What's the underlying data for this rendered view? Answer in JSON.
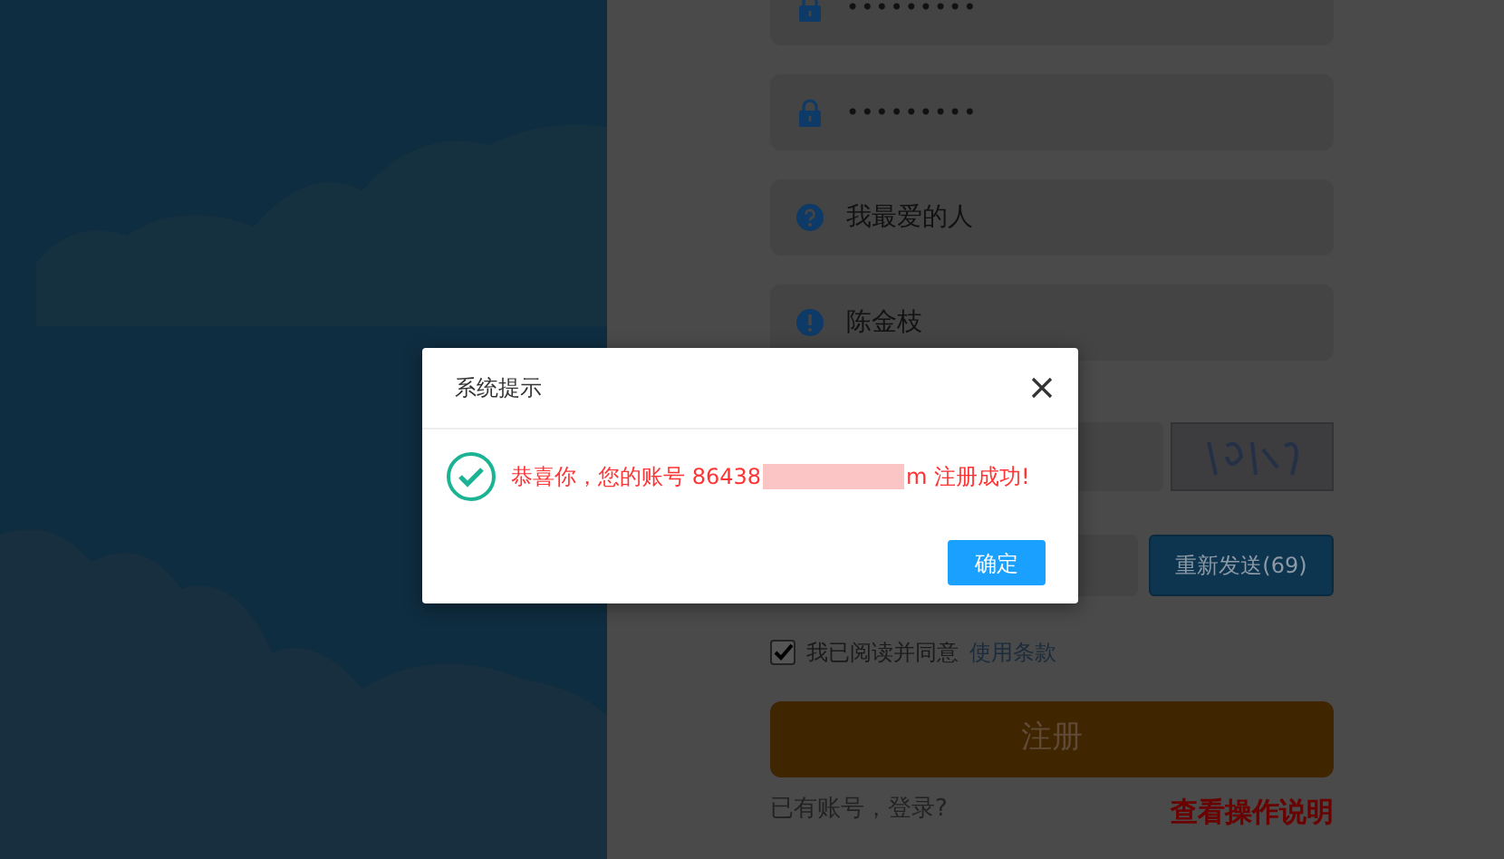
{
  "form": {
    "fields": [
      {
        "kind": "password",
        "value": "•••••••••"
      },
      {
        "kind": "password",
        "value": "•••••••••"
      },
      {
        "kind": "question",
        "value": "我最爱的人"
      },
      {
        "kind": "answer",
        "value": "陈金枝"
      }
    ],
    "resend_button": "重新发送(69)",
    "agreement": {
      "checked": true,
      "label": "我已阅读并同意",
      "link": "使用条款"
    },
    "register_button": "注册",
    "login_link": "已有账号，登录?",
    "help_link": "查看操作说明"
  },
  "dialog": {
    "title": "系统提示",
    "message_before": "恭喜你，您的账号 86438",
    "message_after": "m 注册成功!",
    "ok_button": "确定"
  }
}
